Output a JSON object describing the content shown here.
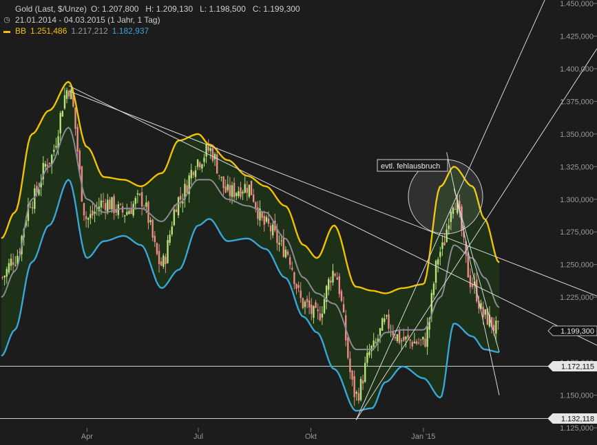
{
  "legend": {
    "title": "Gold (Last, $/Unze)",
    "ohlc": "O: 1.207,800   H: 1.209,130   L: 1.198,500   C: 1.199,300",
    "range": "21.01.2014 - 04.03.2015 (1 Jahr, 1 Tag)",
    "bb_label": "BB",
    "bb_upper": "1.251,486",
    "bb_mid": "1.217,212",
    "bb_lower": "1.182,937"
  },
  "annotation": "evtl. fehlausbruch",
  "colors": {
    "background": "#1c1c1c",
    "bb_upper": "#f2c200",
    "bb_mid": "#8a8a96",
    "bb_lower": "#3aa6d8",
    "band_fill": "#1d3318",
    "candle_up": "#b8e27a",
    "candle_down": "#ef8a8a",
    "lines": "#d9d9d9"
  },
  "chart_data": {
    "type": "candlestick",
    "instrument": "Gold (Last, $/Unze)",
    "ylim": [
      1125,
      1450
    ],
    "y_ticks": [
      "1.125,000",
      "1.150,000",
      "1.175,000",
      "1.200,000",
      "1.225,000",
      "1.250,000",
      "1.275,000",
      "1.300,000",
      "1.325,000",
      "1.350,000",
      "1.375,000",
      "1.400,000",
      "1.425,000",
      "1.450,000"
    ],
    "y_tick_values": [
      1125,
      1150,
      1175,
      1200,
      1225,
      1250,
      1275,
      1300,
      1325,
      1350,
      1375,
      1400,
      1425,
      1450
    ],
    "x_labels": [
      "Apr",
      "Jul",
      "Okt",
      "Jan '15"
    ],
    "x_label_dates": [
      "2014-04-01",
      "2014-07-01",
      "2014-10-01",
      "2015-01-01"
    ],
    "x_range": [
      "2014-01-21",
      "2015-03-04"
    ],
    "price_tags": [
      {
        "label": "1.199,300",
        "value": 1199.3,
        "style": "dark"
      },
      {
        "label": "1.172,115",
        "value": 1172.115,
        "style": "light"
      },
      {
        "label": "1.132,118",
        "value": 1132.118,
        "style": "light"
      }
    ],
    "horizontal_lines": [
      1172.115,
      1132.118
    ],
    "trend_lines": [
      {
        "from": [
          "2014-03-17",
          1387
        ],
        "to": [
          "2015-03-04",
          1225
        ]
      },
      {
        "from": [
          "2014-03-17",
          1383
        ],
        "to": [
          "2015-03-04",
          1255
        ]
      },
      {
        "from": [
          "2014-11-07",
          1131
        ],
        "to": [
          "2015-03-04",
          1375
        ]
      },
      {
        "from": [
          "2014-11-07",
          1131
        ],
        "to": [
          "2015-03-04",
          1300
        ]
      },
      {
        "from": [
          "2015-01-20",
          1336
        ],
        "to": [
          "2015-03-04",
          1150
        ]
      },
      {
        "from": [
          "2015-01-26",
          1308
        ],
        "to": [
          "2015-03-04",
          1183
        ]
      }
    ],
    "close_series": {
      "dates": [
        "2014-01-21",
        "2014-02-01",
        "2014-02-15",
        "2014-03-01",
        "2014-03-17",
        "2014-04-01",
        "2014-04-15",
        "2014-05-01",
        "2014-05-15",
        "2014-06-01",
        "2014-06-15",
        "2014-07-01",
        "2014-07-10",
        "2014-07-25",
        "2014-08-10",
        "2014-08-25",
        "2014-09-10",
        "2014-09-25",
        "2014-10-06",
        "2014-10-20",
        "2014-11-07",
        "2014-11-20",
        "2014-12-01",
        "2014-12-15",
        "2015-01-01",
        "2015-01-15",
        "2015-01-26",
        "2015-02-10",
        "2015-02-20",
        "2015-03-04"
      ],
      "values": [
        1240,
        1255,
        1300,
        1330,
        1385,
        1285,
        1298,
        1290,
        1300,
        1250,
        1300,
        1330,
        1338,
        1305,
        1310,
        1280,
        1262,
        1220,
        1210,
        1245,
        1150,
        1185,
        1205,
        1192,
        1190,
        1260,
        1300,
        1235,
        1210,
        1199.3
      ]
    },
    "bollinger": {
      "dates": [
        "2014-01-21",
        "2014-02-01",
        "2014-02-15",
        "2014-03-01",
        "2014-03-17",
        "2014-04-01",
        "2014-04-15",
        "2014-05-01",
        "2014-05-15",
        "2014-06-01",
        "2014-06-15",
        "2014-07-01",
        "2014-07-10",
        "2014-07-25",
        "2014-08-10",
        "2014-08-25",
        "2014-09-10",
        "2014-09-25",
        "2014-10-06",
        "2014-10-20",
        "2014-11-07",
        "2014-11-20",
        "2014-12-01",
        "2014-12-15",
        "2015-01-01",
        "2015-01-15",
        "2015-01-26",
        "2015-02-10",
        "2015-02-20",
        "2015-03-04"
      ],
      "upper": [
        1270,
        1290,
        1350,
        1368,
        1390,
        1340,
        1317,
        1315,
        1310,
        1320,
        1345,
        1350,
        1342,
        1330,
        1318,
        1310,
        1295,
        1265,
        1255,
        1280,
        1233,
        1230,
        1228,
        1232,
        1235,
        1310,
        1325,
        1310,
        1285,
        1251.5
      ],
      "middle": [
        1225,
        1245,
        1300,
        1325,
        1355,
        1300,
        1290,
        1293,
        1293,
        1283,
        1297,
        1315,
        1315,
        1300,
        1295,
        1290,
        1270,
        1240,
        1228,
        1220,
        1185,
        1185,
        1198,
        1200,
        1200,
        1225,
        1265,
        1255,
        1240,
        1217.2
      ],
      "lower": [
        1180,
        1200,
        1252,
        1280,
        1315,
        1255,
        1268,
        1272,
        1265,
        1232,
        1246,
        1280,
        1285,
        1268,
        1270,
        1262,
        1240,
        1210,
        1198,
        1170,
        1138,
        1140,
        1160,
        1172,
        1163,
        1148,
        1205,
        1195,
        1185,
        1182.9
      ]
    }
  }
}
